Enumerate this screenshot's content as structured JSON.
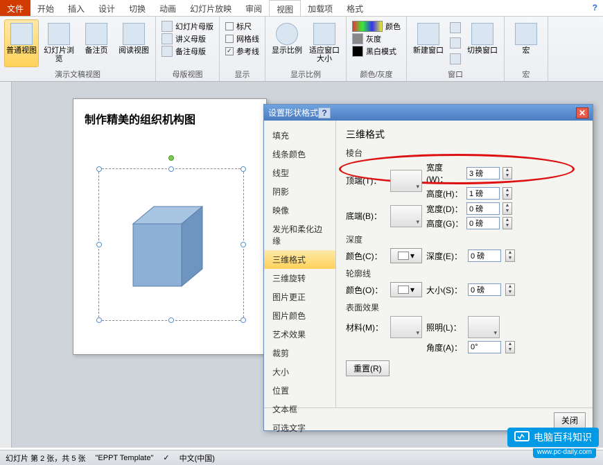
{
  "tabs": {
    "file": "文件",
    "items": [
      "开始",
      "插入",
      "设计",
      "切换",
      "动画",
      "幻灯片放映",
      "审阅",
      "视图",
      "加载项",
      "格式"
    ],
    "active": "视图"
  },
  "ribbon": {
    "g1": {
      "label": "演示文稿视图",
      "btns": [
        "普通视图",
        "幻灯片浏览",
        "备注页",
        "阅读视图"
      ]
    },
    "g2": {
      "label": "母版视图",
      "items": [
        "幻灯片母版",
        "讲义母版",
        "备注母版"
      ]
    },
    "g3": {
      "label": "显示",
      "items": [
        "标尺",
        "网格线",
        "参考线"
      ]
    },
    "g4": {
      "label": "显示比例",
      "btns": [
        "显示比例",
        "适应窗口大小"
      ]
    },
    "g5": {
      "label": "颜色/灰度",
      "items": [
        "颜色",
        "灰度",
        "黑白模式"
      ]
    },
    "g6": {
      "label": "窗口",
      "btns": [
        "新建窗口",
        "",
        "切换窗口"
      ]
    },
    "g7": {
      "label": "宏",
      "btn": "宏"
    }
  },
  "slide": {
    "title": "制作精美的组织机构图"
  },
  "dialog": {
    "title": "设置形状格式",
    "nav": [
      "填充",
      "线条颜色",
      "线型",
      "阴影",
      "映像",
      "发光和柔化边缘",
      "三维格式",
      "三维旋转",
      "图片更正",
      "图片颜色",
      "艺术效果",
      "裁剪",
      "大小",
      "位置",
      "文本框",
      "可选文字"
    ],
    "nav_sel": "三维格式",
    "heading": "三维格式",
    "bevel_label": "棱台",
    "top": "顶端(T)：",
    "bottom": "底端(B)：",
    "width": "宽度(W)：",
    "height": "高度(H)：",
    "width2": "宽度(D)：",
    "height2": "高度(G)：",
    "val_3pt": "3 磅",
    "val_1pt": "1 磅",
    "val_0pt": "0 磅",
    "depth_label": "深度",
    "color": "颜色(C)：",
    "depth": "深度(E)：",
    "contour_label": "轮廓线",
    "color2": "颜色(O)：",
    "size": "大小(S)：",
    "surface_label": "表面效果",
    "material": "材料(M)：",
    "lighting": "照明(L)：",
    "angle": "角度(A)：",
    "val_0deg": "0°",
    "reset": "重置(R)",
    "close": "关闭"
  },
  "status": {
    "slide": "幻灯片 第 2 张，共 5 张",
    "template": "\"EPPT Template\"",
    "lang": "中文(中国)"
  },
  "watermark": {
    "main": "电脑百科知识",
    "sub": "www.pc-daily.com"
  }
}
